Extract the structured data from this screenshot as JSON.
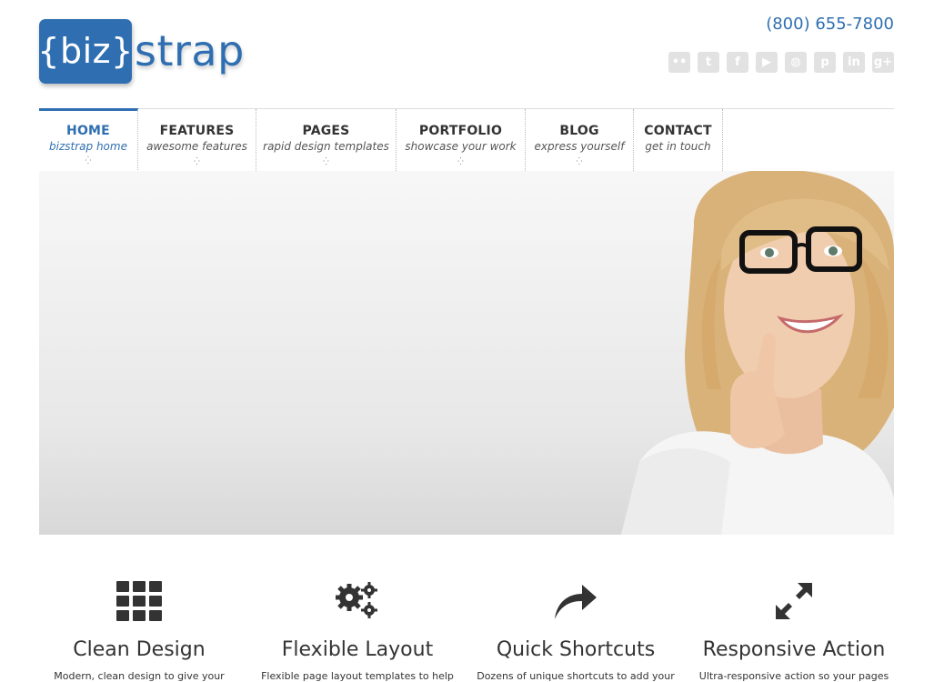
{
  "logo": {
    "box_text": "{biz}",
    "text": "strap",
    "color": "#2f6fb1"
  },
  "header": {
    "phone": "(800) 655-7800",
    "social": [
      {
        "name": "flickr-icon",
        "glyph": "••"
      },
      {
        "name": "twitter-icon",
        "glyph": "t"
      },
      {
        "name": "facebook-icon",
        "glyph": "f"
      },
      {
        "name": "youtube-icon",
        "glyph": "▶"
      },
      {
        "name": "dribbble-icon",
        "glyph": "◍"
      },
      {
        "name": "pinterest-icon",
        "glyph": "p"
      },
      {
        "name": "linkedin-icon",
        "glyph": "in"
      },
      {
        "name": "google-plus-icon",
        "glyph": "g+"
      }
    ]
  },
  "nav": {
    "items": [
      {
        "title": "HOME",
        "sub": "bizstrap home"
      },
      {
        "title": "FEATURES",
        "sub": "awesome features"
      },
      {
        "title": "PAGES",
        "sub": "rapid design templates"
      },
      {
        "title": "PORTFOLIO",
        "sub": "showcase your work"
      },
      {
        "title": "BLOG",
        "sub": "express yourself"
      },
      {
        "title": "CONTACT",
        "sub": "get in touch"
      }
    ]
  },
  "features": [
    {
      "title": "Clean Design",
      "text": "Modern, clean design to give your",
      "icon": "grid-icon"
    },
    {
      "title": "Flexible Layout",
      "text": "Flexible page layout templates to help",
      "icon": "gears-icon"
    },
    {
      "title": "Quick Shortcuts",
      "text": "Dozens of unique shortcuts to add your",
      "icon": "share-arrow-icon"
    },
    {
      "title": "Responsive Action",
      "text": "Ultra-responsive action so your pages",
      "icon": "expand-arrows-icon"
    }
  ]
}
